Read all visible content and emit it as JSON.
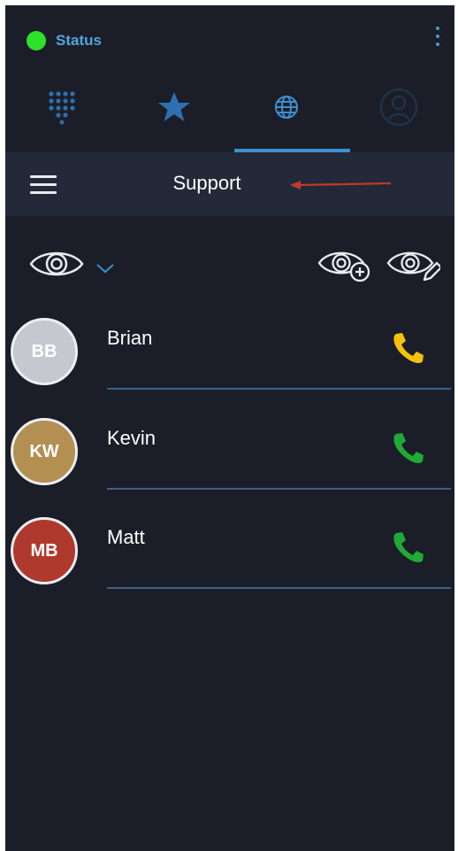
{
  "status": {
    "label": "Status",
    "color": "#2fe02a"
  },
  "tabs": [
    {
      "name": "dialpad",
      "icon": "dialpad-icon",
      "active": false
    },
    {
      "name": "favorites",
      "icon": "star-icon",
      "active": false
    },
    {
      "name": "directory",
      "icon": "globe-icon",
      "active": true
    },
    {
      "name": "profile",
      "icon": "person-icon",
      "active": false
    }
  ],
  "header": {
    "title": "Support"
  },
  "toolbar": {
    "view_icon": "eye-icon",
    "dropdown_icon": "chevron-down-icon",
    "add_view_icon": "eye-add-icon",
    "edit_view_icon": "eye-edit-icon"
  },
  "contacts": [
    {
      "initials": "BB",
      "name": "Brian",
      "avatar_color": "#c5c8ce",
      "call_color": "#f4c20d"
    },
    {
      "initials": "KW",
      "name": "Kevin",
      "avatar_color": "#b38f52",
      "call_color": "#1faa35"
    },
    {
      "initials": "MB",
      "name": "Matt",
      "avatar_color": "#b0392e",
      "call_color": "#1faa35"
    }
  ],
  "colors": {
    "background": "#1b1e28",
    "header_bg": "#232939",
    "accent": "#3d8fd0",
    "annotation_arrow": "#c0392b"
  }
}
